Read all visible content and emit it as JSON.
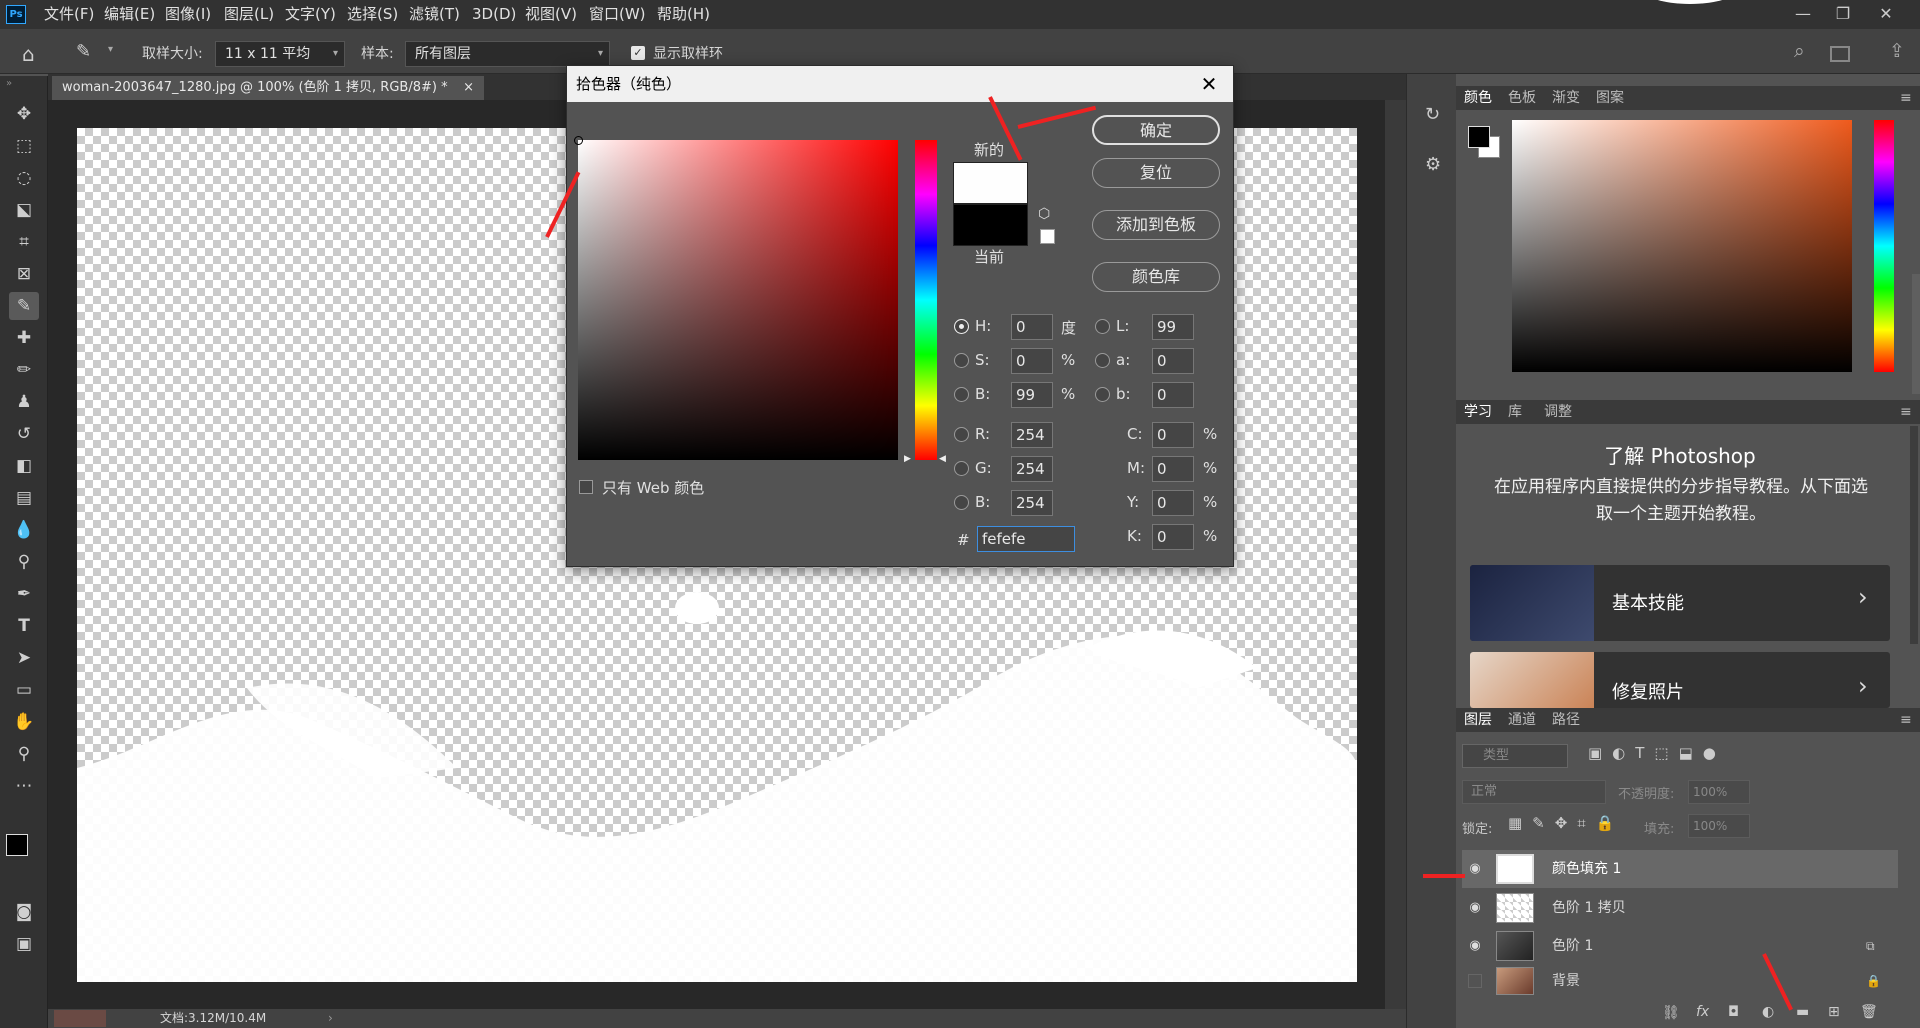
{
  "menubar": {
    "logo": "Ps",
    "items": [
      "文件(F)",
      "编辑(E)",
      "图像(I)",
      "图层(L)",
      "文字(Y)",
      "选择(S)",
      "滤镜(T)",
      "3D(D)",
      "视图(V)",
      "窗口(W)",
      "帮助(H)"
    ],
    "window_controls": [
      "—",
      "❐",
      "✕"
    ]
  },
  "options": {
    "sample_size_label": "取样大小:",
    "sample_size_value": "11 x 11 平均",
    "sample_label": "样本:",
    "sample_value": "所有图层",
    "show_ring_label": "显示取样环"
  },
  "document": {
    "tab_title": "woman-2003647_1280.jpg @ 100% (色阶 1 拷贝, RGB/8#) *",
    "tab_close": "×",
    "status": "文档:3.12M/10.4M"
  },
  "color_picker": {
    "title": "拾色器（纯色）",
    "close": "✕",
    "new_label": "新的",
    "current_label": "当前",
    "buttons": {
      "ok": "确定",
      "reset": "复位",
      "add_swatch": "添加到色板",
      "libraries": "颜色库"
    },
    "web_only_label": "只有 Web 颜色",
    "hsb": [
      {
        "label": "H:",
        "value": "0",
        "unit": "度"
      },
      {
        "label": "S:",
        "value": "0",
        "unit": "%"
      },
      {
        "label": "B:",
        "value": "99",
        "unit": "%"
      }
    ],
    "lab": [
      {
        "label": "L:",
        "value": "99"
      },
      {
        "label": "a:",
        "value": "0"
      },
      {
        "label": "b:",
        "value": "0"
      }
    ],
    "rgb": [
      {
        "label": "R:",
        "value": "254"
      },
      {
        "label": "G:",
        "value": "254"
      },
      {
        "label": "B:",
        "value": "254"
      }
    ],
    "cmyk": [
      {
        "label": "C:",
        "value": "0",
        "unit": "%"
      },
      {
        "label": "M:",
        "value": "0",
        "unit": "%"
      },
      {
        "label": "Y:",
        "value": "0",
        "unit": "%"
      },
      {
        "label": "K:",
        "value": "0",
        "unit": "%"
      }
    ],
    "hex_label": "#",
    "hex_value": "fefefe",
    "new_color": "#fefefe",
    "current_color": "#000000"
  },
  "color_panel": {
    "tabs": [
      "颜色",
      "色板",
      "渐变",
      "图案"
    ]
  },
  "learn_panel": {
    "tabs": [
      "学习",
      "库",
      "调整"
    ],
    "heading": "了解 Photoshop",
    "description": "在应用程序内直接提供的分步指导教程。从下面选取一个主题开始教程。",
    "cards": [
      {
        "label": "基本技能"
      },
      {
        "label": "修复照片"
      }
    ]
  },
  "layers_panel": {
    "tabs": [
      "图层",
      "通道",
      "路径"
    ],
    "filter_placeholder": "类型",
    "blend_mode": "正常",
    "opacity_label": "不透明度:",
    "opacity_value": "100%",
    "lock_label": "锁定:",
    "fill_label": "填充:",
    "fill_value": "100%",
    "layers": [
      {
        "name": "颜色填充 1",
        "visible": true,
        "selected": true
      },
      {
        "name": "色阶 1 拷贝",
        "visible": true,
        "selected": false
      },
      {
        "name": "色阶 1",
        "visible": true,
        "selected": false
      },
      {
        "name": "背景",
        "visible": false,
        "selected": false
      }
    ]
  }
}
